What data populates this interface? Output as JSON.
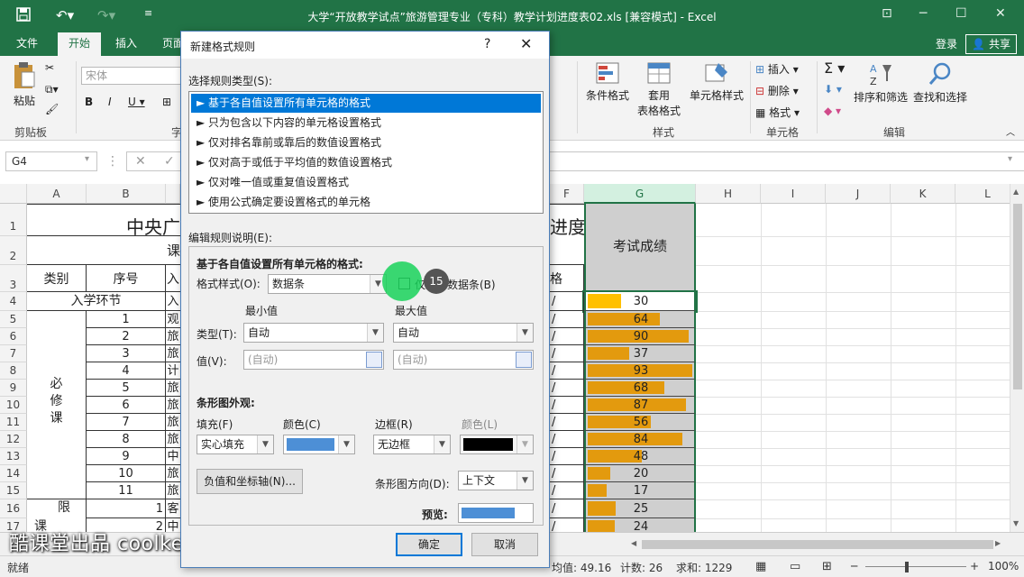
{
  "window": {
    "title": "大学“开放教学试点”旅游管理专业（专科）教学计划进度表02.xls  [兼容模式] - Excel"
  },
  "tabs": [
    "文件",
    "开始",
    "插入",
    "页面"
  ],
  "account": {
    "login": "登录",
    "share": "共享"
  },
  "ribbon": {
    "paste": "粘贴",
    "clipboard": "剪贴板",
    "font_name": "宋体",
    "font_group_partial": "字",
    "cond_format": "条件格式",
    "table_format_1": "套用",
    "table_format_2": "表格格式",
    "cell_style": "单元格样式",
    "style_group": "样式",
    "insert": "插入",
    "delete": "删除",
    "format": "格式",
    "cells_group": "单元格",
    "sort_filter": "排序和筛选",
    "find_select": "查找和选择",
    "edit_group": "编辑"
  },
  "formula_bar": {
    "name_box": "G4"
  },
  "columns": [
    "A",
    "B",
    "C",
    "D",
    "E",
    "F",
    "G",
    "H",
    "I",
    "J",
    "K",
    "L"
  ],
  "rows": [
    "1",
    "2",
    "3",
    "4",
    "5",
    "6",
    "7",
    "8",
    "9",
    "10",
    "11",
    "12",
    "13",
    "14",
    "15",
    "16",
    "17"
  ],
  "sheet": {
    "title_left": "中央广",
    "title_right": "进度表",
    "row2_partial": "课",
    "hdr_category": "类别",
    "hdr_seq": "序号",
    "hdr_c": "入",
    "hdr_f": "格",
    "hdr_g": "考试成绩",
    "intake": "入学环节",
    "intake_c": "入",
    "required": "必修课",
    "limited": "限",
    "course_partial": "课",
    "seq": [
      "1",
      "2",
      "3",
      "4",
      "5",
      "6",
      "7",
      "8",
      "9",
      "10",
      "11"
    ],
    "col_c": [
      "观",
      "旅",
      "旅",
      "计",
      "旅",
      "旅",
      "旅",
      "旅",
      "中",
      "旅",
      "旅"
    ],
    "row16_b": "1",
    "row16_c": "客",
    "row17_b": "2",
    "row17_c": "中",
    "col_f_mark": "/",
    "scores": [
      30,
      64,
      90,
      37,
      93,
      68,
      87,
      56,
      84,
      48,
      20,
      17,
      25,
      24
    ]
  },
  "status": {
    "ready": "就绪",
    "average": "均值: 49.16",
    "count": "计数: 26",
    "sum": "求和: 1229",
    "zoom": "100%"
  },
  "watermark": "酷课堂出品 coolketang.com",
  "dialog": {
    "title": "新建格式规则",
    "help": "?",
    "section_rule_type": "选择规则类型(S):",
    "rule_types": [
      "► 基于各自值设置所有单元格的格式",
      "► 只为包含以下内容的单元格设置格式",
      "► 仅对排名靠前或靠后的数值设置格式",
      "► 仅对高于或低于平均值的数值设置格式",
      "► 仅对唯一值或重复值设置格式",
      "► 使用公式确定要设置格式的单元格"
    ],
    "section_edit": "编辑规则说明(E):",
    "format_all": "基于各自值设置所有单元格的格式:",
    "format_style_label": "格式样式(O):",
    "format_style_value": "数据条",
    "show_bar_only": "仅显示数据条(B)",
    "min_label": "最小值",
    "max_label": "最大值",
    "type_label": "类型(T):",
    "min_type": "自动",
    "max_type": "自动",
    "value_label": "值(V):",
    "min_value": "(自动)",
    "max_value": "(自动)",
    "bar_appearance": "条形图外观:",
    "fill_label": "填充(F)",
    "color_label": "颜色(C)",
    "border_label": "边框(R)",
    "border_color_label": "颜色(L)",
    "fill_value": "实心填充",
    "border_value": "无边框",
    "neg_axis_button": "负值和坐标轴(N)...",
    "direction_label": "条形图方向(D):",
    "direction_value": "上下文",
    "preview_label": "预览:",
    "ok": "确定",
    "cancel": "取消",
    "step_badge": "15",
    "bar_color": "#4d8fd6",
    "border_color": "#000000"
  }
}
